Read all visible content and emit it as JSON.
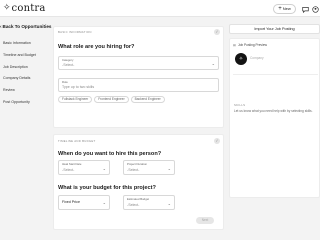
{
  "brand": {
    "logo_mark": "✧",
    "logo_text": "contra"
  },
  "topbar": {
    "new_button_plus": "+",
    "new_button_label": "New"
  },
  "sidebar": {
    "back_label": "Back To Opportunities",
    "items": [
      {
        "label": "Basic Information"
      },
      {
        "label": "Timeline and Budget"
      },
      {
        "label": "Job Description"
      },
      {
        "label": "Company Details"
      },
      {
        "label": "Review"
      },
      {
        "label": "Post Opportunity"
      }
    ]
  },
  "basic_info": {
    "section_label": "BASIC INFORMATION",
    "heading": "What role are you hiring for?",
    "category": {
      "label": "Category",
      "placeholder": "-Select-"
    },
    "role": {
      "label": "Role",
      "placeholder": "Type up to two skills"
    },
    "suggestions": [
      "Fullstack Engineer",
      "Frontend Engineer",
      "Backend Engineer"
    ]
  },
  "timeline_budget": {
    "section_label": "TIMELINE AND BUDGET",
    "when_heading": "When do you want to hire this person?",
    "start_date": {
      "label": "Ideal Start Date",
      "placeholder": "-Select-"
    },
    "duration": {
      "label": "Project Duration",
      "placeholder": "-Select-"
    },
    "budget_heading": "What is your budget for this project?",
    "budget_type": {
      "value": "Fixed Price"
    },
    "estimated_budget": {
      "label": "Estimated Budget",
      "placeholder": "-Select-"
    },
    "save_label": "Next"
  },
  "right_panel": {
    "import_label": "Import Your Job Posting",
    "preview_title": "Job Posting Preview",
    "avatar_initial": "✧",
    "company_placeholder": "Company",
    "skills_label": "SKILLS",
    "skills_help": "Let us know what you need help with by selecting skills."
  }
}
